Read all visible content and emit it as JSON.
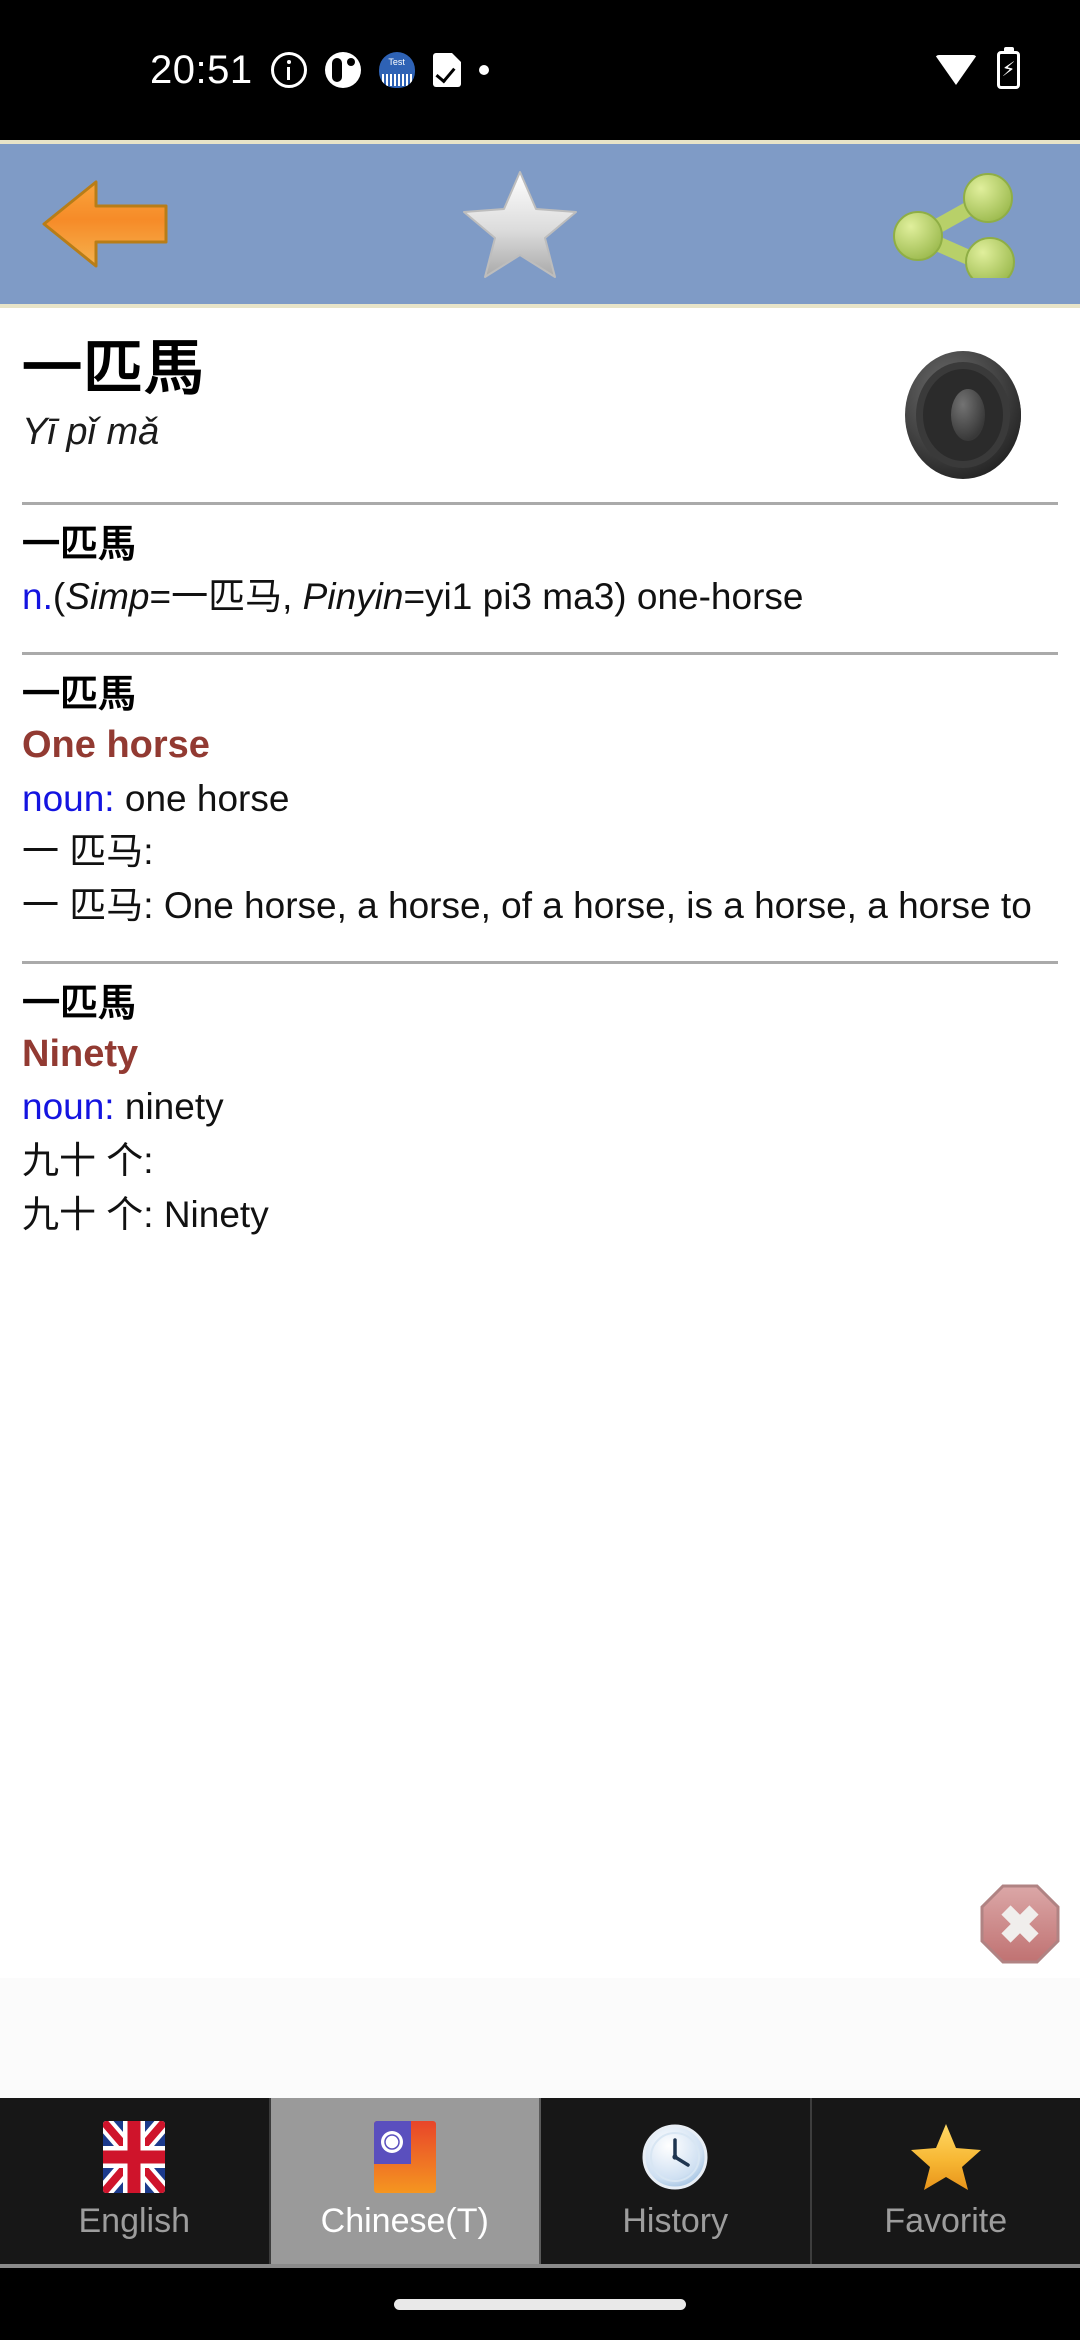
{
  "status_bar": {
    "clock": "20:51",
    "left_icons": [
      "info-icon",
      "notification-blob-icon",
      "test-app-icon",
      "checklist-doc-icon",
      "dot-icon"
    ],
    "right_icons": [
      "wifi-icon",
      "battery-charging-icon"
    ]
  },
  "toolbar": {
    "background_color": "#7f9bc6",
    "back_label": "Back",
    "favorite_label": "Favorite",
    "share_label": "Share",
    "icons": [
      "back-arrow-icon",
      "star-outline-icon",
      "share-icon"
    ]
  },
  "headword": {
    "word": "一匹馬",
    "pinyin": "Yī pǐ mǎ",
    "speaker_label": "Pronounce"
  },
  "entries": [
    {
      "headword": "一匹馬",
      "pos": "n.",
      "pos_color": "#1414e0",
      "gloss_prefix": "(",
      "simp_label": "Simp",
      "simp_value": "=一匹马, ",
      "pinyin_label": "Pinyin",
      "pinyin_value": "=yi1 pi3 ma3) one-horse"
    },
    {
      "headword": "一匹馬",
      "title": "One horse",
      "title_color": "#923a32",
      "pos": "noun:",
      "pos_value": " one horse",
      "line3": "一 匹马:",
      "line4": "一 匹马: One horse, a horse, of a horse, is a horse, a horse to"
    },
    {
      "headword": "一匹馬",
      "title": "Ninety",
      "title_color": "#923a32",
      "pos": "noun:",
      "pos_value": " ninety",
      "line3": "九十 个:",
      "line4": "九十 个: Ninety"
    }
  ],
  "ad": {
    "close_label": "Close ad",
    "close_icon": "close-octagon-icon"
  },
  "bottom_nav": {
    "tabs": [
      {
        "label": "English",
        "icon": "uk-flag-icon",
        "selected": false
      },
      {
        "label": "Chinese(T)",
        "icon": "taiwan-flag-icon",
        "selected": true
      },
      {
        "label": "History",
        "icon": "clock-icon",
        "selected": false
      },
      {
        "label": "Favorite",
        "icon": "star-filled-icon",
        "selected": false
      }
    ]
  },
  "gesture_bar": {
    "label": "Home gesture bar"
  }
}
